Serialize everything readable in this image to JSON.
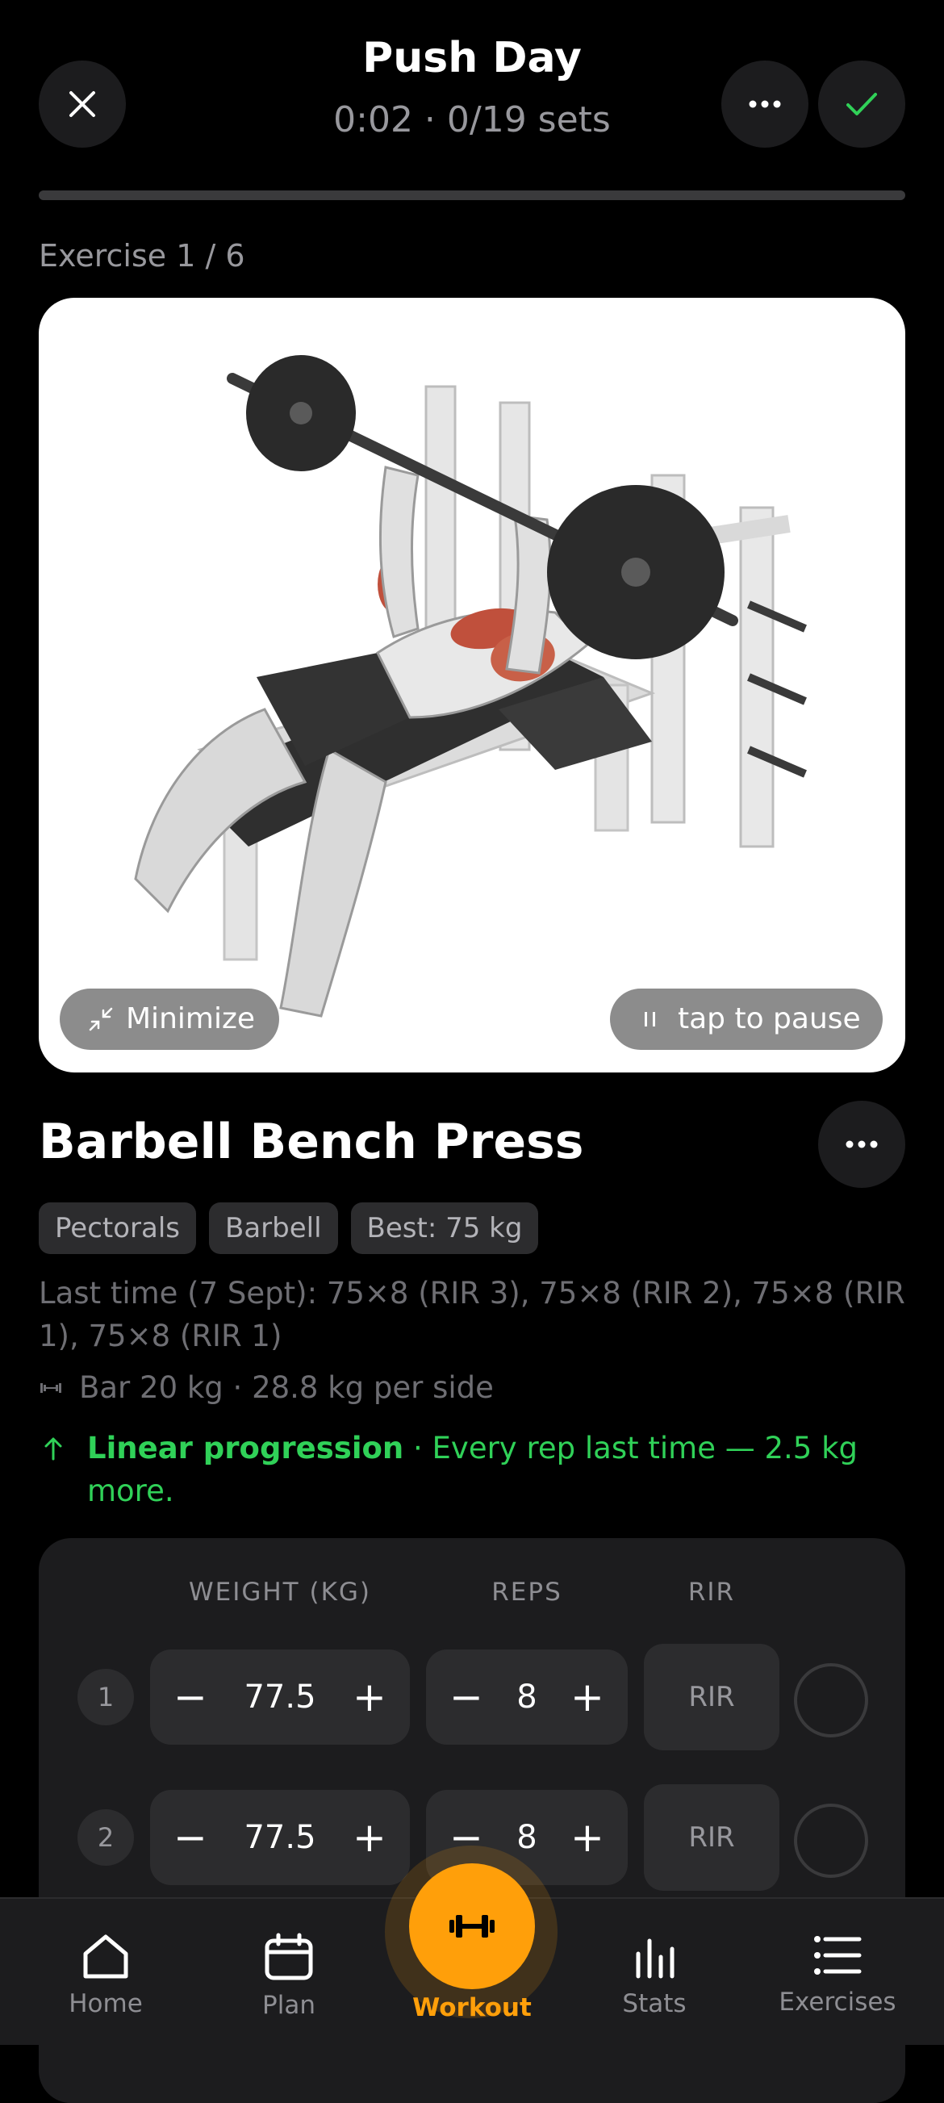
{
  "header": {
    "title": "Push Day",
    "subtitle": "0:02 · 0/19 sets",
    "progress": 0
  },
  "exercise_counter": "Exercise 1 / 6",
  "media": {
    "minimize_label": "Minimize",
    "pause_label": "tap to pause"
  },
  "exercise": {
    "name": "Barbell Bench Press",
    "tags": [
      "Pectorals",
      "Barbell",
      "Best: 75 kg"
    ],
    "last_time": "Last time (7 Sept): 75×8 (RIR 3), 75×8 (RIR 2), 75×8 (RIR 1), 75×8 (RIR 1)",
    "bar_info": "Bar 20 kg · 28.8 kg per side",
    "progression_title": "Linear progression",
    "progression_text": " · Every rep last time — 2.5 kg more."
  },
  "sets_table": {
    "headers": {
      "weight": "WEIGHT (KG)",
      "reps": "REPS",
      "rir": "RIR"
    },
    "rows": [
      {
        "num": "1",
        "weight": "77.5",
        "reps": "8",
        "rir": "RIR"
      },
      {
        "num": "2",
        "weight": "77.5",
        "reps": "8",
        "rir": "RIR"
      }
    ]
  },
  "tabs": {
    "home": "Home",
    "plan": "Plan",
    "workout": "Workout",
    "stats": "Stats",
    "exercises": "Exercises"
  },
  "colors": {
    "accent": "#ff9f0a",
    "success": "#30d158",
    "background": "#000000",
    "surface": "#1c1c1e"
  }
}
